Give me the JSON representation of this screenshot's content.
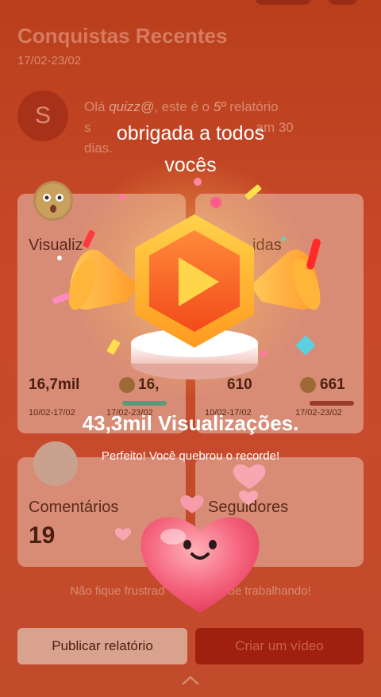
{
  "header": {
    "title": "Conquistas Recentes",
    "dates": "17/02-23/02"
  },
  "intro": {
    "avatar_letter": "S",
    "part1": "Olá ",
    "username": "quizz@",
    "part2": ", este é o ",
    "number": "5º",
    "part3": " relatório",
    "line2_visible": "s",
    "line2_tail": "am 30",
    "line3": "dias."
  },
  "cards": {
    "views": {
      "label_visible": "Visualiz",
      "value_prev": "16,7mil",
      "dates_prev": "10/02-17/02",
      "value_curr_visible": "16,",
      "dates_curr_visible": "17/02-23/02"
    },
    "second": {
      "label_visible": "idas",
      "value_prev_visible": "610",
      "dates_prev": "10/02-17/02",
      "value_curr": "661",
      "dates_curr": "17/02-23/02"
    },
    "comments": {
      "label": "Comentários",
      "value": "19"
    },
    "followers": {
      "label": "Seguidores"
    }
  },
  "encourage_left": "Não fique frustrad",
  "encourage_right": "ue trabalhando!",
  "buttons": {
    "publish": "Publicar relatório",
    "create": "Criar um vídeo"
  },
  "overlay": {
    "thanks_line1": "obrigada a todos",
    "thanks_line2": "vocês",
    "total_views": "43,3mil Visualizações.",
    "record_message": "Perfeito! Você quebrou o recorde!"
  },
  "colors": {
    "accent_red": "#a0200f",
    "badge_orange": "#ff6a2a",
    "heart_pink": "#f4607a"
  },
  "icons": [
    "avatar-icon",
    "surprised-face-icon",
    "cool-face-icon",
    "speech-bubble-icon",
    "play-badge-icon",
    "trumpet-icon",
    "heart-face-icon",
    "chevron-up-icon"
  ]
}
